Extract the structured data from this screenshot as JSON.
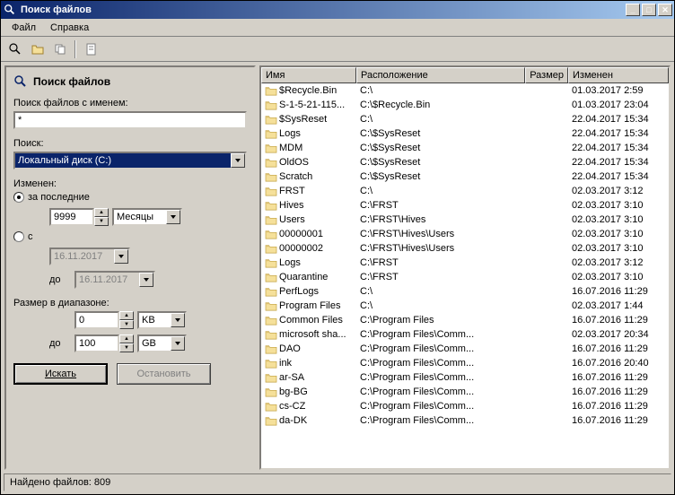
{
  "window": {
    "title": "Поиск файлов"
  },
  "menubar": {
    "items": [
      "Файл",
      "Справка"
    ]
  },
  "panel": {
    "title": "Поиск файлов",
    "name_label": "Поиск файлов с именем:",
    "name_value": "*",
    "search_label": "Поиск:",
    "search_value": "Локальный диск (C:)",
    "modified_label": "Изменен:",
    "radio_last": "за последние",
    "last_value": "9999",
    "last_unit": "Месяцы",
    "radio_from": "с",
    "date_from": "16.11.2017",
    "date_to_label": "до",
    "date_to": "16.11.2017",
    "size_label": "Размер в диапазоне:",
    "size_from": "0",
    "size_from_unit": "KB",
    "size_to_label": "до",
    "size_to": "100",
    "size_to_unit": "GB",
    "search_btn": "Искать",
    "stop_btn": "Остановить"
  },
  "table": {
    "headers": {
      "name": "Имя",
      "location": "Расположение",
      "size": "Размер",
      "modified": "Изменен"
    },
    "rows": [
      {
        "name": "$Recycle.Bin",
        "loc": "C:\\",
        "size": "",
        "mod": "01.03.2017 2:59"
      },
      {
        "name": "S-1-5-21-115...",
        "loc": "C:\\$Recycle.Bin",
        "size": "",
        "mod": "01.03.2017 23:04"
      },
      {
        "name": "$SysReset",
        "loc": "C:\\",
        "size": "",
        "mod": "22.04.2017 15:34"
      },
      {
        "name": "Logs",
        "loc": "C:\\$SysReset",
        "size": "",
        "mod": "22.04.2017 15:34"
      },
      {
        "name": "MDM",
        "loc": "C:\\$SysReset",
        "size": "",
        "mod": "22.04.2017 15:34"
      },
      {
        "name": "OldOS",
        "loc": "C:\\$SysReset",
        "size": "",
        "mod": "22.04.2017 15:34"
      },
      {
        "name": "Scratch",
        "loc": "C:\\$SysReset",
        "size": "",
        "mod": "22.04.2017 15:34"
      },
      {
        "name": "FRST",
        "loc": "C:\\",
        "size": "",
        "mod": "02.03.2017 3:12"
      },
      {
        "name": "Hives",
        "loc": "C:\\FRST",
        "size": "",
        "mod": "02.03.2017 3:10"
      },
      {
        "name": "Users",
        "loc": "C:\\FRST\\Hives",
        "size": "",
        "mod": "02.03.2017 3:10"
      },
      {
        "name": "00000001",
        "loc": "C:\\FRST\\Hives\\Users",
        "size": "",
        "mod": "02.03.2017 3:10"
      },
      {
        "name": "00000002",
        "loc": "C:\\FRST\\Hives\\Users",
        "size": "",
        "mod": "02.03.2017 3:10"
      },
      {
        "name": "Logs",
        "loc": "C:\\FRST",
        "size": "",
        "mod": "02.03.2017 3:12"
      },
      {
        "name": "Quarantine",
        "loc": "C:\\FRST",
        "size": "",
        "mod": "02.03.2017 3:10"
      },
      {
        "name": "PerfLogs",
        "loc": "C:\\",
        "size": "",
        "mod": "16.07.2016 11:29"
      },
      {
        "name": "Program Files",
        "loc": "C:\\",
        "size": "",
        "mod": "02.03.2017 1:44"
      },
      {
        "name": "Common Files",
        "loc": "C:\\Program Files",
        "size": "",
        "mod": "16.07.2016 11:29"
      },
      {
        "name": "microsoft sha...",
        "loc": "C:\\Program Files\\Comm...",
        "size": "",
        "mod": "02.03.2017 20:34"
      },
      {
        "name": "DAO",
        "loc": "C:\\Program Files\\Comm...",
        "size": "",
        "mod": "16.07.2016 11:29"
      },
      {
        "name": "ink",
        "loc": "C:\\Program Files\\Comm...",
        "size": "",
        "mod": "16.07.2016 20:40"
      },
      {
        "name": "ar-SA",
        "loc": "C:\\Program Files\\Comm...",
        "size": "",
        "mod": "16.07.2016 11:29"
      },
      {
        "name": "bg-BG",
        "loc": "C:\\Program Files\\Comm...",
        "size": "",
        "mod": "16.07.2016 11:29"
      },
      {
        "name": "cs-CZ",
        "loc": "C:\\Program Files\\Comm...",
        "size": "",
        "mod": "16.07.2016 11:29"
      },
      {
        "name": "da-DK",
        "loc": "C:\\Program Files\\Comm...",
        "size": "",
        "mod": "16.07.2016 11:29"
      }
    ]
  },
  "statusbar": {
    "text": "Найдено файлов: 809"
  }
}
